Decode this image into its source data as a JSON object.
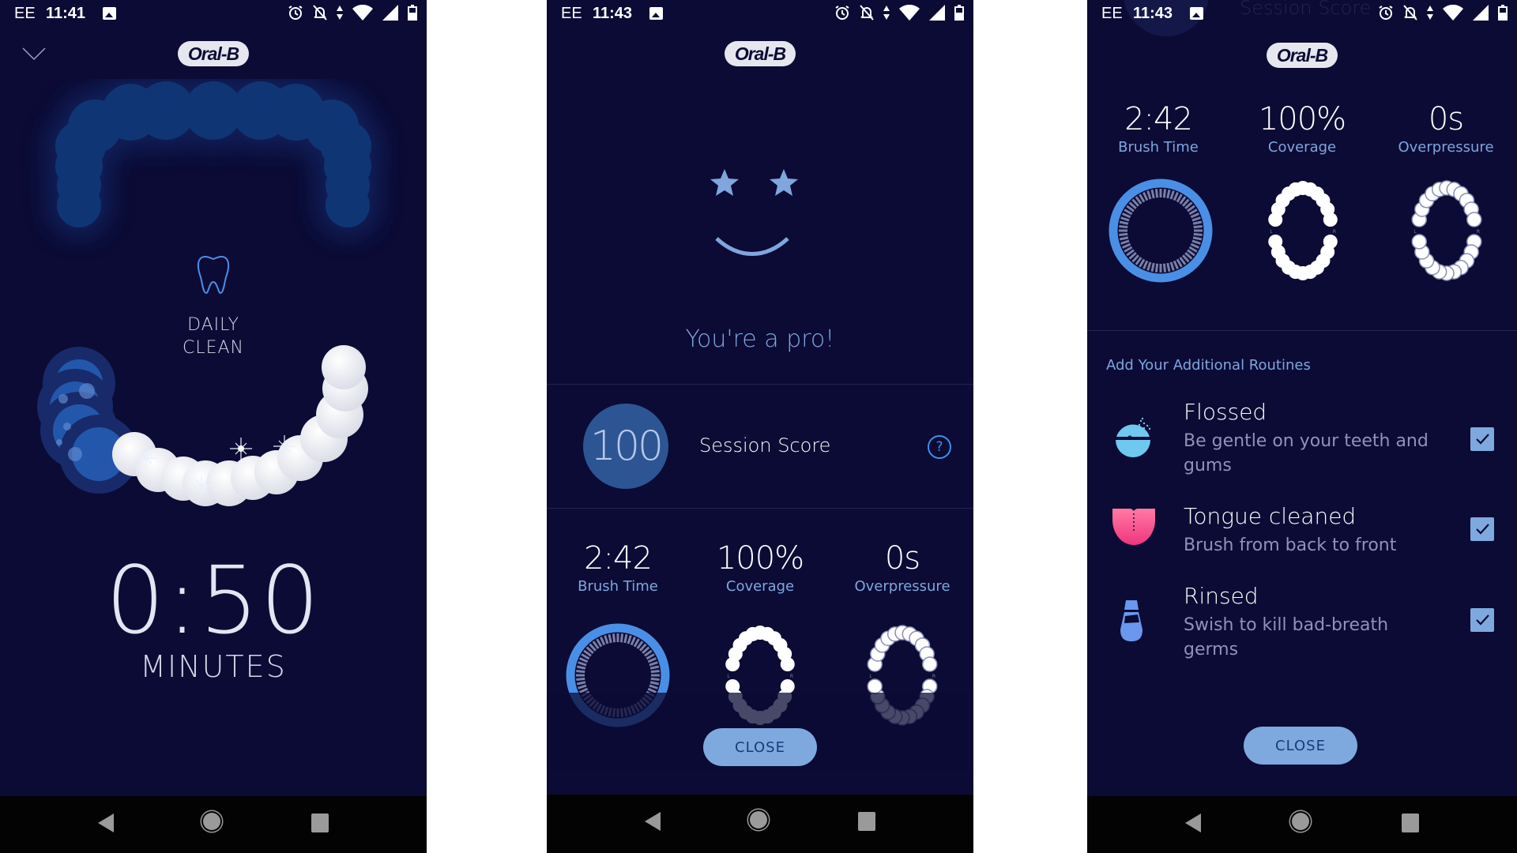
{
  "status_bars": [
    {
      "carrier": "EE",
      "time": "11:41"
    },
    {
      "carrier": "EE",
      "time": "11:43"
    },
    {
      "carrier": "EE",
      "time": "11:43"
    }
  ],
  "brand": {
    "logo_text": "Oral-B"
  },
  "brushing_screen": {
    "mode_line1": "DAILY",
    "mode_line2": "CLEAN",
    "timer": "0:50",
    "timer_unit": "MINUTES",
    "icons": {
      "collapse": "chevron-down-icon",
      "mode": "tooth-icon"
    }
  },
  "summary_screen": {
    "message": "You're a pro!",
    "score": "100",
    "score_label": "Session Score",
    "help_icon": "?",
    "stats": [
      {
        "value": "2:42",
        "label": "Brush Time"
      },
      {
        "value": "100%",
        "label": "Coverage"
      },
      {
        "value": "0s",
        "label": "Overpressure"
      }
    ],
    "close_label": "CLOSE"
  },
  "routines_screen": {
    "faded_header": "Session Score",
    "stats": [
      {
        "value": "2:42",
        "label": "Brush Time"
      },
      {
        "value": "100%",
        "label": "Coverage"
      },
      {
        "value": "0s",
        "label": "Overpressure"
      }
    ],
    "section_title": "Add Your Additional Routines",
    "routines": [
      {
        "title": "Flossed",
        "subtitle": "Be gentle on your teeth and gums",
        "checked": true,
        "icon": "floss-icon"
      },
      {
        "title": "Tongue cleaned",
        "subtitle": "Brush from back to front",
        "checked": true,
        "icon": "tongue-icon"
      },
      {
        "title": "Rinsed",
        "subtitle": "Swish to kill bad-breath germs",
        "checked": true,
        "icon": "mouthwash-icon"
      }
    ],
    "close_label": "CLOSE"
  },
  "jaw_labels": {
    "left": "L",
    "right": "R"
  },
  "colors": {
    "background": "#0b0b35",
    "accent_blue": "#7ea9de",
    "ring_blue": "#4a8fe6",
    "score_circle": "#2d5593",
    "tongue_pink": "#f0508f",
    "floss_cyan": "#6fc8f0"
  }
}
